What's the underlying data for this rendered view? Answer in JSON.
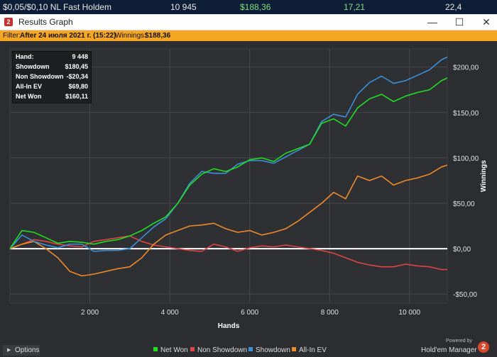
{
  "topbar": {
    "game": "$0,05/$0,10 NL Fast Holdem",
    "hands": "10 945",
    "winnings": "$188,36",
    "bb100": "17,21",
    "last": "22,4"
  },
  "window": {
    "title": "Results Graph",
    "min": "—",
    "max": "☐",
    "close": "✕"
  },
  "filter": {
    "label": "Filter:",
    "value": "After 24 июля 2021 г. (15:22)",
    "winnings_label": "Winnings:",
    "winnings_value": "$188,36"
  },
  "info": {
    "hand_label": "Hand:",
    "hand_value": "9 448",
    "showdown_label": "Showdown",
    "showdown_value": "$180,45",
    "nonshowdown_label": "Non Showdown",
    "nonshowdown_value": "-$20,34",
    "allin_label": "All-In EV",
    "allin_value": "$69,80",
    "netwon_label": "Net Won",
    "netwon_value": "$160,11"
  },
  "options_label": "Options",
  "powered_by": "Powered by",
  "brand": "Hold'em Manager",
  "brand_logo": "2",
  "colors": {
    "net_won": "#22dd22",
    "non_showdown": "#e04444",
    "showdown": "#3b8fd9",
    "all_in_ev": "#ef8a2a",
    "zero_line": "#ffffff",
    "grid": "#45484c",
    "filter_bg": "#f5a623"
  },
  "chart_data": {
    "type": "line",
    "title": "",
    "xlabel": "Hands",
    "ylabel": "Winnings",
    "xlim": [
      0,
      10945
    ],
    "ylim": [
      -60,
      220
    ],
    "x_ticks": [
      2000,
      4000,
      6000,
      8000,
      10000
    ],
    "x_tick_labels": [
      "2 000",
      "4 000",
      "6 000",
      "8 000",
      "10 000"
    ],
    "y_ticks": [
      -50,
      0,
      50,
      100,
      150,
      200
    ],
    "y_tick_labels": [
      "-$50,00",
      "$0,00",
      "$50,00",
      "$100,00",
      "$150,00",
      "$200,00"
    ],
    "grid": true,
    "legend_position": "bottom",
    "x": [
      0,
      300,
      600,
      900,
      1200,
      1500,
      1800,
      2100,
      2400,
      2700,
      3000,
      3300,
      3600,
      3900,
      4200,
      4500,
      4800,
      5100,
      5400,
      5700,
      6000,
      6300,
      6600,
      6900,
      7200,
      7500,
      7800,
      8100,
      8400,
      8700,
      9000,
      9300,
      9600,
      9900,
      10200,
      10500,
      10800,
      10945
    ],
    "series": [
      {
        "name": "Net Won",
        "color": "#22dd22",
        "values": [
          0,
          20,
          18,
          12,
          6,
          8,
          7,
          5,
          8,
          10,
          14,
          20,
          28,
          35,
          50,
          70,
          82,
          88,
          85,
          90,
          98,
          100,
          96,
          105,
          110,
          115,
          138,
          143,
          135,
          155,
          165,
          170,
          162,
          168,
          172,
          175,
          185,
          188
        ]
      },
      {
        "name": "Non Showdown",
        "color": "#e04444",
        "values": [
          0,
          5,
          10,
          8,
          5,
          3,
          2,
          8,
          10,
          12,
          14,
          8,
          4,
          2,
          0,
          -2,
          -3,
          5,
          2,
          -3,
          1,
          3,
          2,
          4,
          2,
          0,
          -2,
          -5,
          -10,
          -15,
          -18,
          -20,
          -20,
          -17,
          -19,
          -20,
          -23,
          -23
        ]
      },
      {
        "name": "Showdown",
        "color": "#3b8fd9",
        "values": [
          0,
          15,
          8,
          4,
          1,
          5,
          5,
          -3,
          -2,
          -2,
          0,
          12,
          24,
          33,
          50,
          72,
          85,
          83,
          83,
          93,
          97,
          97,
          94,
          101,
          108,
          115,
          140,
          148,
          145,
          170,
          183,
          190,
          182,
          185,
          191,
          197,
          208,
          211
        ]
      },
      {
        "name": "All-In EV",
        "color": "#ef8a2a",
        "values": [
          0,
          5,
          8,
          0,
          -10,
          -25,
          -30,
          -28,
          -25,
          -22,
          -20,
          -10,
          5,
          15,
          20,
          25,
          26,
          28,
          22,
          18,
          20,
          15,
          18,
          22,
          30,
          40,
          50,
          62,
          55,
          80,
          75,
          80,
          70,
          75,
          78,
          82,
          90,
          92
        ]
      }
    ]
  }
}
